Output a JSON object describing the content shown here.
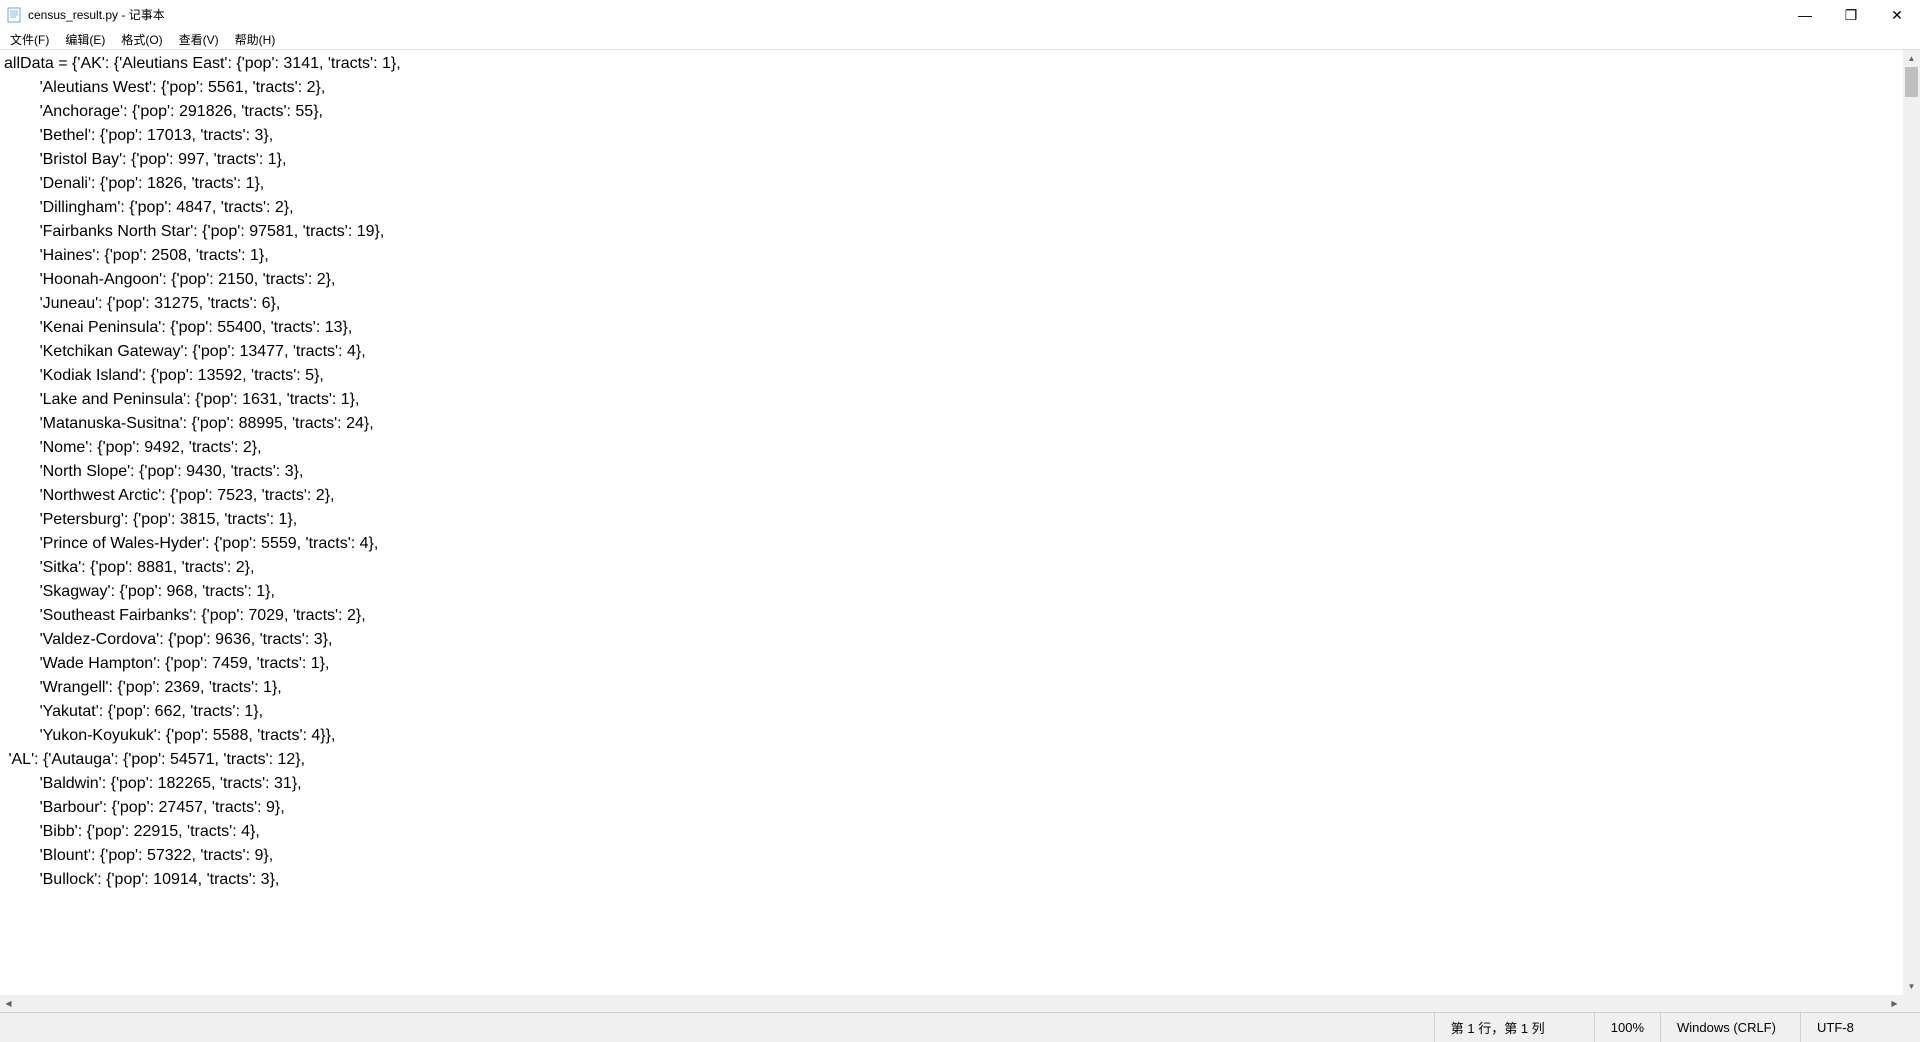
{
  "window": {
    "title": "census_result.py - 记事本"
  },
  "menu": {
    "file": "文件(F)",
    "edit": "编辑(E)",
    "format": "格式(O)",
    "view": "查看(V)",
    "help": "帮助(H)"
  },
  "controls": {
    "minimize": "—",
    "maximize": "❐",
    "close": "✕"
  },
  "content": "allData = {'AK': {'Aleutians East': {'pop': 3141, 'tracts': 1},\n        'Aleutians West': {'pop': 5561, 'tracts': 2},\n        'Anchorage': {'pop': 291826, 'tracts': 55},\n        'Bethel': {'pop': 17013, 'tracts': 3},\n        'Bristol Bay': {'pop': 997, 'tracts': 1},\n        'Denali': {'pop': 1826, 'tracts': 1},\n        'Dillingham': {'pop': 4847, 'tracts': 2},\n        'Fairbanks North Star': {'pop': 97581, 'tracts': 19},\n        'Haines': {'pop': 2508, 'tracts': 1},\n        'Hoonah-Angoon': {'pop': 2150, 'tracts': 2},\n        'Juneau': {'pop': 31275, 'tracts': 6},\n        'Kenai Peninsula': {'pop': 55400, 'tracts': 13},\n        'Ketchikan Gateway': {'pop': 13477, 'tracts': 4},\n        'Kodiak Island': {'pop': 13592, 'tracts': 5},\n        'Lake and Peninsula': {'pop': 1631, 'tracts': 1},\n        'Matanuska-Susitna': {'pop': 88995, 'tracts': 24},\n        'Nome': {'pop': 9492, 'tracts': 2},\n        'North Slope': {'pop': 9430, 'tracts': 3},\n        'Northwest Arctic': {'pop': 7523, 'tracts': 2},\n        'Petersburg': {'pop': 3815, 'tracts': 1},\n        'Prince of Wales-Hyder': {'pop': 5559, 'tracts': 4},\n        'Sitka': {'pop': 8881, 'tracts': 2},\n        'Skagway': {'pop': 968, 'tracts': 1},\n        'Southeast Fairbanks': {'pop': 7029, 'tracts': 2},\n        'Valdez-Cordova': {'pop': 9636, 'tracts': 3},\n        'Wade Hampton': {'pop': 7459, 'tracts': 1},\n        'Wrangell': {'pop': 2369, 'tracts': 1},\n        'Yakutat': {'pop': 662, 'tracts': 1},\n        'Yukon-Koyukuk': {'pop': 5588, 'tracts': 4}},\n 'AL': {'Autauga': {'pop': 54571, 'tracts': 12},\n        'Baldwin': {'pop': 182265, 'tracts': 31},\n        'Barbour': {'pop': 27457, 'tracts': 9},\n        'Bibb': {'pop': 22915, 'tracts': 4},\n        'Blount': {'pop': 57322, 'tracts': 9},\n        'Bullock': {'pop': 10914, 'tracts': 3},",
  "status": {
    "position": "第 1 行，第 1 列",
    "zoom": "100%",
    "eol": "Windows (CRLF)",
    "encoding": "UTF-8"
  }
}
